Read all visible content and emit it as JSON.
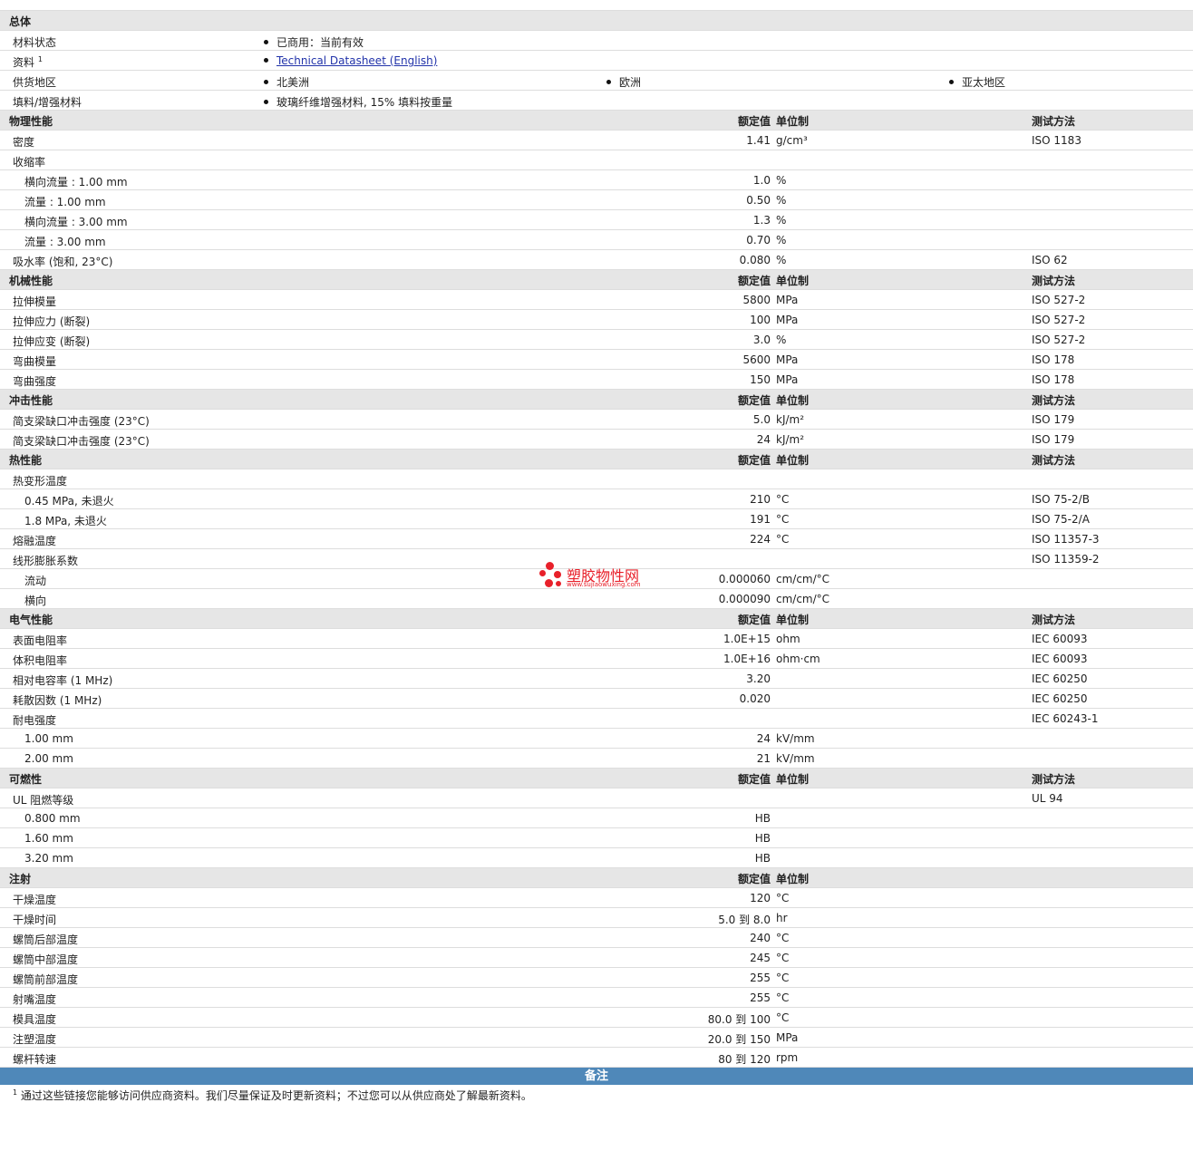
{
  "general": {
    "title": "总体",
    "rows": {
      "status": {
        "label": "材料状态",
        "value": "已商用：当前有效"
      },
      "docs": {
        "label": "资料",
        "sup": "1",
        "link": "Technical Datasheet (English)"
      },
      "regions": {
        "label": "供货地区",
        "values": [
          "北美洲",
          "欧洲",
          "亚太地区"
        ]
      },
      "filler": {
        "label": "填料/增强材料",
        "value": "玻璃纤维增强材料, 15% 填料按重量"
      }
    }
  },
  "headers": {
    "value": "额定值",
    "unit": "单位制",
    "test": "测试方法"
  },
  "sections": [
    {
      "title": "物理性能",
      "show_test": true,
      "rows": [
        {
          "name": "密度",
          "value": "1.41",
          "unit": "g/cm³",
          "test": "ISO 1183"
        },
        {
          "name": "收缩率",
          "value": "",
          "unit": "",
          "test": ""
        },
        {
          "name": "横向流量 : 1.00 mm",
          "value": "1.0",
          "unit": "%",
          "test": "",
          "indent": true
        },
        {
          "name": "流量 : 1.00 mm",
          "value": "0.50",
          "unit": "%",
          "test": "",
          "indent": true
        },
        {
          "name": "横向流量 : 3.00 mm",
          "value": "1.3",
          "unit": "%",
          "test": "",
          "indent": true
        },
        {
          "name": "流量 : 3.00 mm",
          "value": "0.70",
          "unit": "%",
          "test": "",
          "indent": true
        },
        {
          "name": "吸水率 (饱和, 23°C)",
          "value": "0.080",
          "unit": "%",
          "test": "ISO 62"
        }
      ]
    },
    {
      "title": "机械性能",
      "show_test": true,
      "rows": [
        {
          "name": "拉伸模量",
          "value": "5800",
          "unit": "MPa",
          "test": "ISO 527-2"
        },
        {
          "name": "拉伸应力 (断裂)",
          "value": "100",
          "unit": "MPa",
          "test": "ISO 527-2"
        },
        {
          "name": "拉伸应变 (断裂)",
          "value": "3.0",
          "unit": "%",
          "test": "ISO 527-2"
        },
        {
          "name": "弯曲模量",
          "value": "5600",
          "unit": "MPa",
          "test": "ISO 178"
        },
        {
          "name": "弯曲强度",
          "value": "150",
          "unit": "MPa",
          "test": "ISO 178"
        }
      ]
    },
    {
      "title": "冲击性能",
      "show_test": true,
      "rows": [
        {
          "name": "简支梁缺口冲击强度 (23°C)",
          "value": "5.0",
          "unit": "kJ/m²",
          "test": "ISO 179"
        },
        {
          "name": "简支梁缺口冲击强度 (23°C)",
          "value": "24",
          "unit": "kJ/m²",
          "test": "ISO 179"
        }
      ]
    },
    {
      "title": "热性能",
      "show_test": true,
      "rows": [
        {
          "name": "热变形温度",
          "value": "",
          "unit": "",
          "test": ""
        },
        {
          "name": "0.45 MPa, 未退火",
          "value": "210",
          "unit": "°C",
          "test": "ISO 75-2/B",
          "indent": true
        },
        {
          "name": "1.8 MPa, 未退火",
          "value": "191",
          "unit": "°C",
          "test": "ISO 75-2/A",
          "indent": true
        },
        {
          "name": "熔融温度",
          "value": "224",
          "unit": "°C",
          "test": "ISO 11357-3"
        },
        {
          "name": "线形膨胀系数",
          "value": "",
          "unit": "",
          "test": "ISO 11359-2"
        },
        {
          "name": "流动",
          "value": "0.000060",
          "unit": "cm/cm/°C",
          "test": "",
          "indent": true
        },
        {
          "name": "横向",
          "value": "0.000090",
          "unit": "cm/cm/°C",
          "test": "",
          "indent": true
        }
      ]
    },
    {
      "title": "电气性能",
      "show_test": true,
      "rows": [
        {
          "name": "表面电阻率",
          "value": "1.0E+15",
          "unit": "ohm",
          "test": "IEC 60093"
        },
        {
          "name": "体积电阻率",
          "value": "1.0E+16",
          "unit": "ohm·cm",
          "test": "IEC 60093"
        },
        {
          "name": "相对电容率 (1 MHz)",
          "value": "3.20",
          "unit": "",
          "test": "IEC 60250"
        },
        {
          "name": "耗散因数 (1 MHz)",
          "value": "0.020",
          "unit": "",
          "test": "IEC 60250"
        },
        {
          "name": "耐电强度",
          "value": "",
          "unit": "",
          "test": "IEC 60243-1"
        },
        {
          "name": "1.00 mm",
          "value": "24",
          "unit": "kV/mm",
          "test": "",
          "indent": true
        },
        {
          "name": "2.00 mm",
          "value": "21",
          "unit": "kV/mm",
          "test": "",
          "indent": true
        }
      ]
    },
    {
      "title": "可燃性",
      "show_test": true,
      "rows": [
        {
          "name": "UL 阻燃等级",
          "value": "",
          "unit": "",
          "test": "UL 94"
        },
        {
          "name": "0.800 mm",
          "value": "HB",
          "unit": "",
          "test": "",
          "indent": true
        },
        {
          "name": "1.60 mm",
          "value": "HB",
          "unit": "",
          "test": "",
          "indent": true
        },
        {
          "name": "3.20 mm",
          "value": "HB",
          "unit": "",
          "test": "",
          "indent": true
        }
      ]
    },
    {
      "title": "注射",
      "show_test": false,
      "rows": [
        {
          "name": "干燥温度",
          "value": "120",
          "unit": "°C",
          "test": ""
        },
        {
          "name": "干燥时间",
          "value": "5.0 到  8.0",
          "unit": "hr",
          "test": ""
        },
        {
          "name": "螺筒后部温度",
          "value": "240",
          "unit": "°C",
          "test": ""
        },
        {
          "name": "螺筒中部温度",
          "value": "245",
          "unit": "°C",
          "test": ""
        },
        {
          "name": "螺筒前部温度",
          "value": "255",
          "unit": "°C",
          "test": ""
        },
        {
          "name": "射嘴温度",
          "value": "255",
          "unit": "°C",
          "test": ""
        },
        {
          "name": "模具温度",
          "value": "80.0 到  100",
          "unit": "°C",
          "test": ""
        },
        {
          "name": "注塑温度",
          "value": "20.0 到  150",
          "unit": "MPa",
          "test": ""
        },
        {
          "name": "螺杆转速",
          "value": "80 到  120",
          "unit": "rpm",
          "test": ""
        }
      ]
    }
  ],
  "notes": {
    "title": "备注",
    "items": [
      {
        "sup": "1",
        "text": "通过这些链接您能够访问供应商资料。我们尽量保证及时更新资料；不过您可以从供应商处了解最新资料。"
      }
    ]
  },
  "watermark": {
    "title": "塑胶物性网",
    "url": "www.sujiaowuxing.com",
    "color": "#e8202a"
  }
}
